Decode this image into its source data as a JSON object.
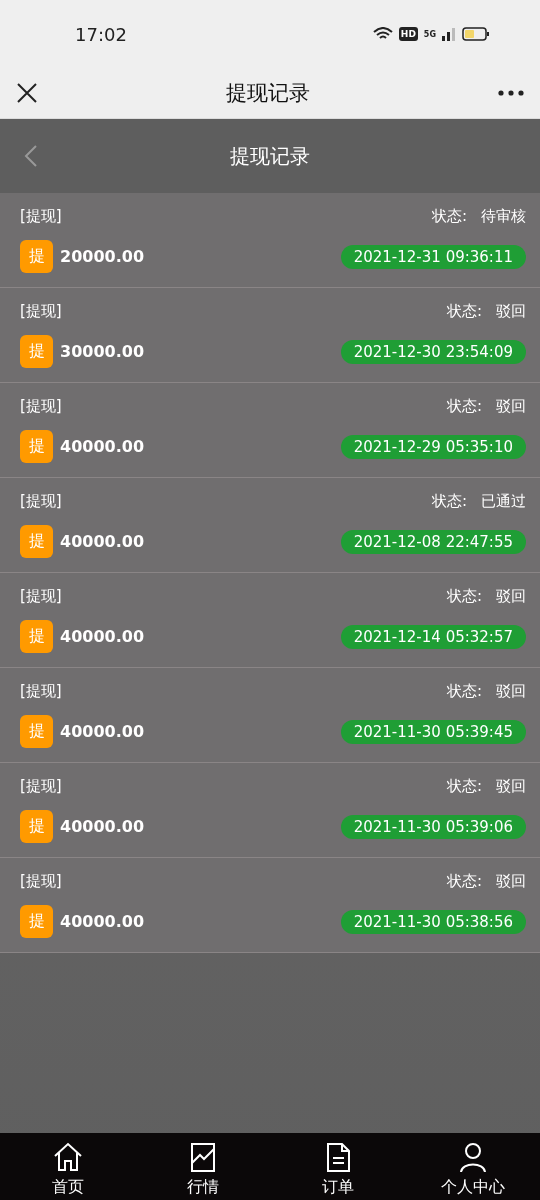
{
  "status_bar": {
    "time": "17:02",
    "hd": "HD",
    "network": "5G"
  },
  "title_bar": {
    "title": "提现记录"
  },
  "header": {
    "title": "提现记录"
  },
  "records": [
    {
      "type": "[提现]",
      "status_label": "状态:",
      "status": "待审核",
      "badge": "提",
      "amount": "20000.00",
      "time": "2021-12-31 09:36:11"
    },
    {
      "type": "[提现]",
      "status_label": "状态:",
      "status": "驳回",
      "badge": "提",
      "amount": "30000.00",
      "time": "2021-12-30 23:54:09"
    },
    {
      "type": "[提现]",
      "status_label": "状态:",
      "status": "驳回",
      "badge": "提",
      "amount": "40000.00",
      "time": "2021-12-29 05:35:10"
    },
    {
      "type": "[提现]",
      "status_label": "状态:",
      "status": "已通过",
      "badge": "提",
      "amount": "40000.00",
      "time": "2021-12-08 22:47:55"
    },
    {
      "type": "[提现]",
      "status_label": "状态:",
      "status": "驳回",
      "badge": "提",
      "amount": "40000.00",
      "time": "2021-12-14 05:32:57"
    },
    {
      "type": "[提现]",
      "status_label": "状态:",
      "status": "驳回",
      "badge": "提",
      "amount": "40000.00",
      "time": "2021-11-30 05:39:45"
    },
    {
      "type": "[提现]",
      "status_label": "状态:",
      "status": "驳回",
      "badge": "提",
      "amount": "40000.00",
      "time": "2021-11-30 05:39:06"
    },
    {
      "type": "[提现]",
      "status_label": "状态:",
      "status": "驳回",
      "badge": "提",
      "amount": "40000.00",
      "time": "2021-11-30 05:38:56"
    }
  ],
  "tab_bar": [
    {
      "label": "首页",
      "kind": "home",
      "selected": false
    },
    {
      "label": "行情",
      "kind": "chart",
      "selected": false
    },
    {
      "label": "订单",
      "kind": "document",
      "selected": false
    },
    {
      "label": "个人中心",
      "kind": "person",
      "selected": false
    }
  ]
}
